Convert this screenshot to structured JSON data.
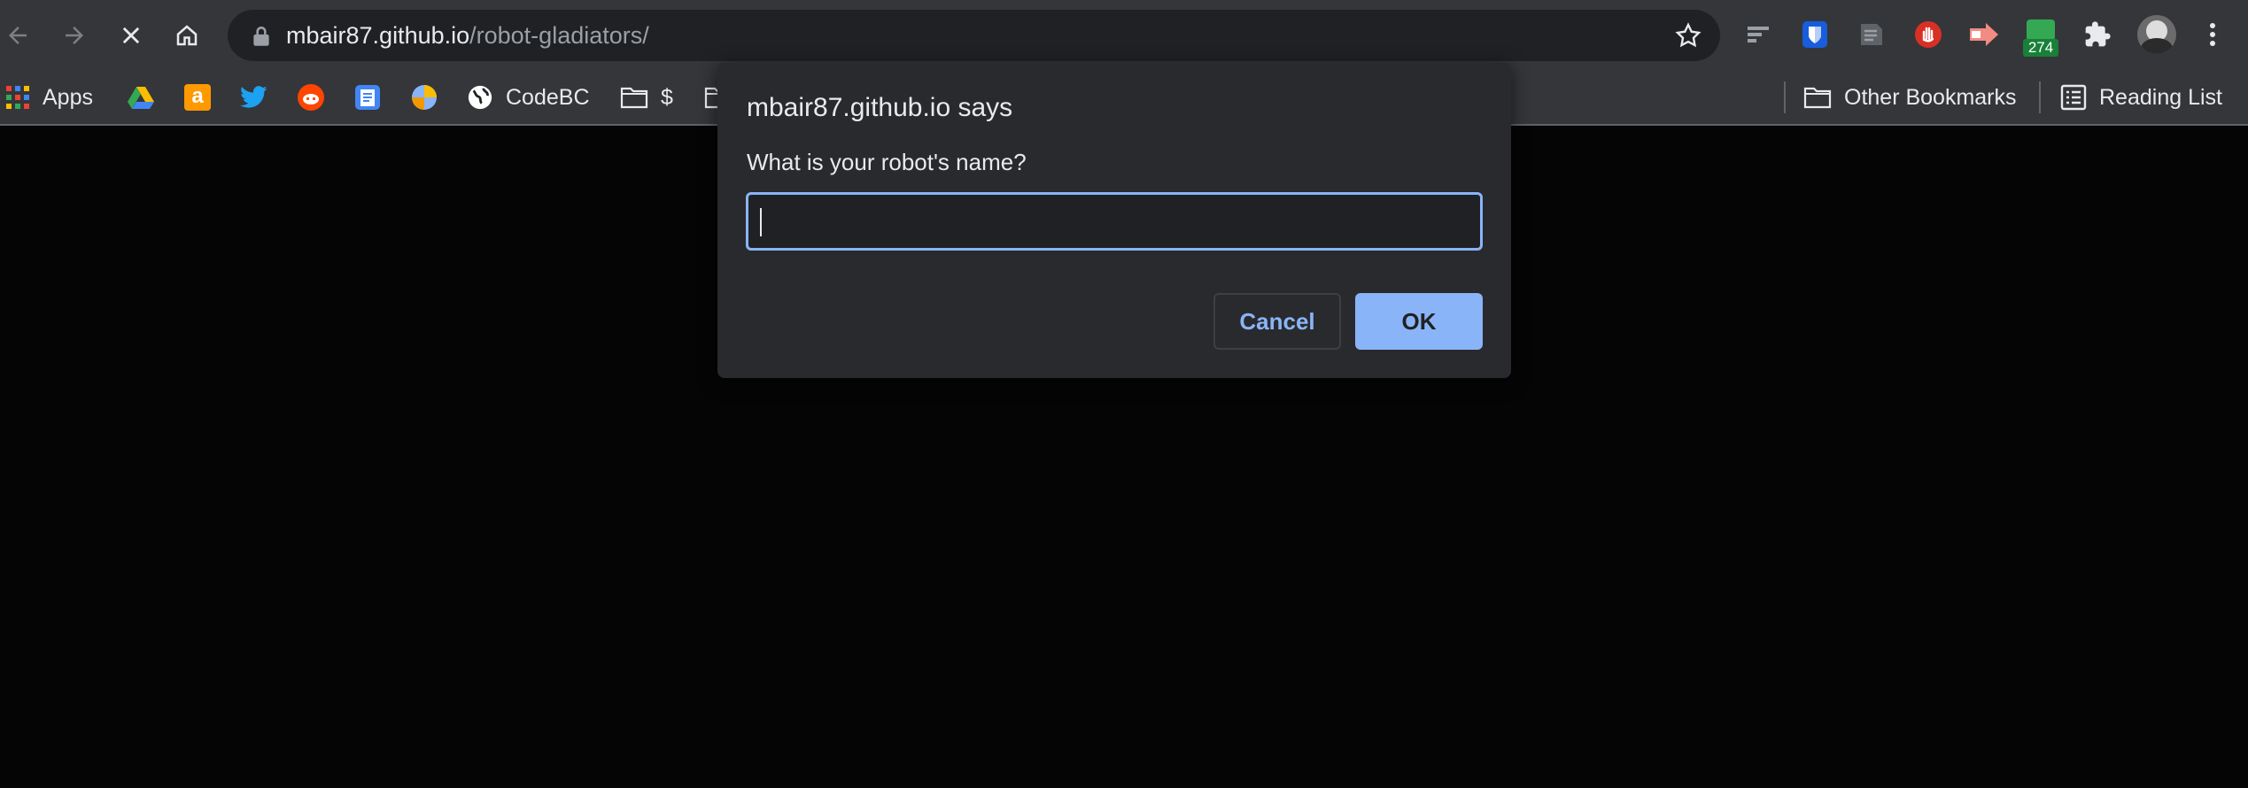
{
  "browser": {
    "url_host": "mbair87.github.io",
    "url_path": "/robot-gladiators/",
    "extension_badge": "274"
  },
  "bookmarks": {
    "items": [
      {
        "label": "Apps",
        "icon": "apps-grid-icon"
      },
      {
        "label": "",
        "icon": "google-drive-icon"
      },
      {
        "label": "",
        "icon": "amazon-icon"
      },
      {
        "label": "",
        "icon": "twitter-icon"
      },
      {
        "label": "",
        "icon": "reddit-icon"
      },
      {
        "label": "",
        "icon": "google-docs-icon"
      },
      {
        "label": "",
        "icon": "colorful-globe-icon"
      },
      {
        "label": "CodeBC",
        "icon": "globe-icon"
      },
      {
        "label": "$",
        "icon": "folder-icon"
      }
    ],
    "other_bookmarks": "Other Bookmarks",
    "reading_list": "Reading List"
  },
  "dialog": {
    "title": "mbair87.github.io says",
    "message": "What is your robot's name?",
    "input_value": "",
    "cancel_label": "Cancel",
    "ok_label": "OK"
  },
  "colors": {
    "toolbar_bg": "#35363a",
    "dialog_bg": "#292a2d",
    "accent": "#8ab4f8",
    "page_bg": "#050505"
  }
}
